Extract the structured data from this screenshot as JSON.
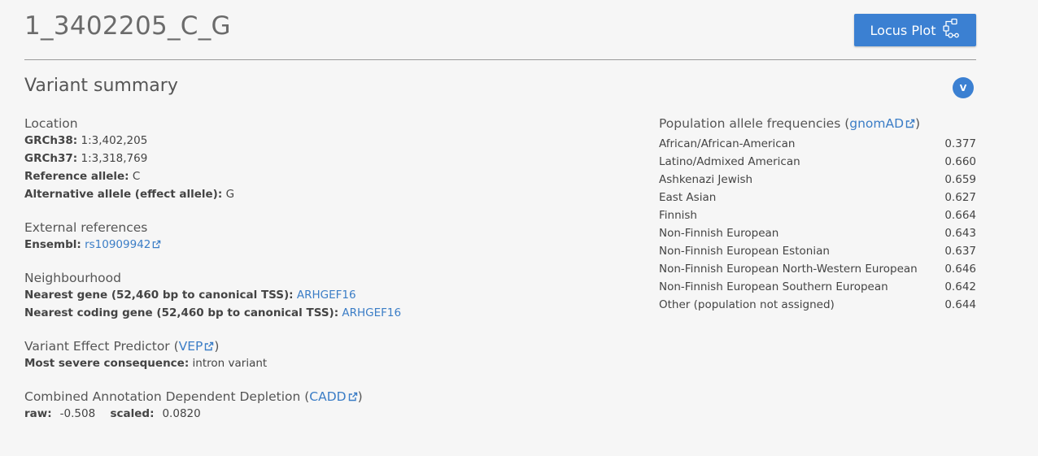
{
  "variant_id": "1_3402205_C_G",
  "locus_button": {
    "label": "Locus Plot",
    "icon": "locus-plot-icon"
  },
  "summary": {
    "title": "Variant summary",
    "toggle_label": "V"
  },
  "location": {
    "heading": "Location",
    "grch38_label": "GRCh38:",
    "grch38_value": "1:3,402,205",
    "grch37_label": "GRCh37:",
    "grch37_value": "1:3,318,769",
    "ref_label": "Reference allele:",
    "ref_value": "C",
    "alt_label": "Alternative allele (effect allele):",
    "alt_value": "G"
  },
  "external_refs": {
    "heading": "External references",
    "ensembl_label": "Ensembl:",
    "ensembl_link": "rs10909942"
  },
  "neighbourhood": {
    "heading": "Neighbourhood",
    "nearest_gene_label": "Nearest gene (52,460 bp to canonical TSS):",
    "nearest_gene": "ARHGEF16",
    "nearest_coding_label": "Nearest coding gene (52,460 bp to canonical TSS):",
    "nearest_coding_gene": "ARHGEF16"
  },
  "vep": {
    "heading_prefix": "Variant Effect Predictor (",
    "link": "VEP",
    "heading_suffix": ")",
    "consequence_label": "Most severe consequence:",
    "consequence_value": "intron variant"
  },
  "cadd": {
    "heading_prefix": "Combined Annotation Dependent Depletion (",
    "link": "CADD",
    "heading_suffix": ")",
    "raw_label": "raw:",
    "raw_value": "-0.508",
    "scaled_label": "scaled:",
    "scaled_value": "0.0820"
  },
  "population": {
    "heading_prefix": "Population allele frequencies (",
    "link": "gnomAD",
    "heading_suffix": ")",
    "rows": [
      {
        "name": "African/African-American",
        "value": "0.377"
      },
      {
        "name": "Latino/Admixed American",
        "value": "0.660"
      },
      {
        "name": "Ashkenazi Jewish",
        "value": "0.659"
      },
      {
        "name": "East Asian",
        "value": "0.627"
      },
      {
        "name": "Finnish",
        "value": "0.664"
      },
      {
        "name": "Non-Finnish European",
        "value": "0.643"
      },
      {
        "name": "Non-Finnish European Estonian",
        "value": "0.637"
      },
      {
        "name": "Non-Finnish European North-Western European",
        "value": "0.646"
      },
      {
        "name": "Non-Finnish European Southern European",
        "value": "0.642"
      },
      {
        "name": "Other (population not assigned)",
        "value": "0.644"
      }
    ]
  },
  "colors": {
    "accent": "#3b80d2",
    "link": "#3b7dc6",
    "background": "#f6f6f6"
  }
}
